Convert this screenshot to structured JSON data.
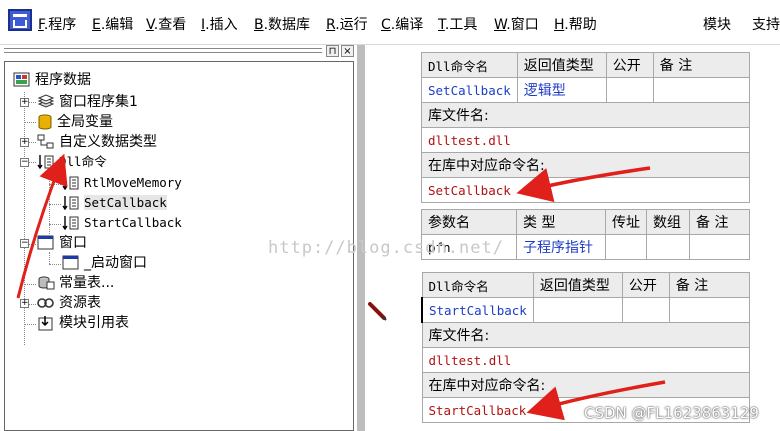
{
  "menu": {
    "items": [
      {
        "key": "F",
        "label": ".程序"
      },
      {
        "key": "E",
        "label": ".编辑"
      },
      {
        "key": "V",
        "label": ".查看"
      },
      {
        "key": "I",
        "label": ".插入"
      },
      {
        "key": "B",
        "label": ".数据库"
      },
      {
        "key": "R",
        "label": ".运行"
      },
      {
        "key": "C",
        "label": ".编译"
      },
      {
        "key": "T",
        "label": ".工具"
      },
      {
        "key": "W",
        "label": ".窗口"
      },
      {
        "key": "H",
        "label": ".帮助"
      }
    ],
    "modules": "模块",
    "support": "支持"
  },
  "panel": {
    "pin": "⊓",
    "close": "×"
  },
  "tree": {
    "root": "程序数据",
    "window_assembly": "窗口程序集1",
    "globals": "全局变量",
    "custom_types": "自定义数据类型",
    "dll_commands": "Dll命令",
    "dll_items": [
      "RtlMoveMemory",
      "SetCallback",
      "StartCallback"
    ],
    "window": "窗口",
    "startup_window": "_启动窗口",
    "constants": "常量表...",
    "resources": "资源表",
    "module_refs": "模块引用表"
  },
  "dll1": {
    "headers": [
      "Dll命令名",
      "返回值类型",
      "公开",
      "备 注"
    ],
    "name": "SetCallback",
    "return_type": "逻辑型",
    "lib_label": "库文件名:",
    "lib_value": "dlltest.dll",
    "cmd_label": "在库中对应命令名:",
    "cmd_value": "SetCallback",
    "param_headers": [
      "参数名",
      "类 型",
      "传址",
      "数组",
      "备 注"
    ],
    "param_name": "pfn",
    "param_type": "子程序指针"
  },
  "dll2": {
    "headers": [
      "Dll命令名",
      "返回值类型",
      "公开",
      "备 注"
    ],
    "name": "StartCallback",
    "lib_label": "库文件名:",
    "lib_value": "dlltest.dll",
    "cmd_label": "在库中对应命令名:",
    "cmd_value": "StartCallback"
  },
  "watermark": "http://blog.csdn.net/",
  "csdn_credit": "CSDN @FL1623863129",
  "colors": {
    "annotation": "#e0201a",
    "blue_text": "#1f3cc6",
    "red_text": "#b01212"
  }
}
